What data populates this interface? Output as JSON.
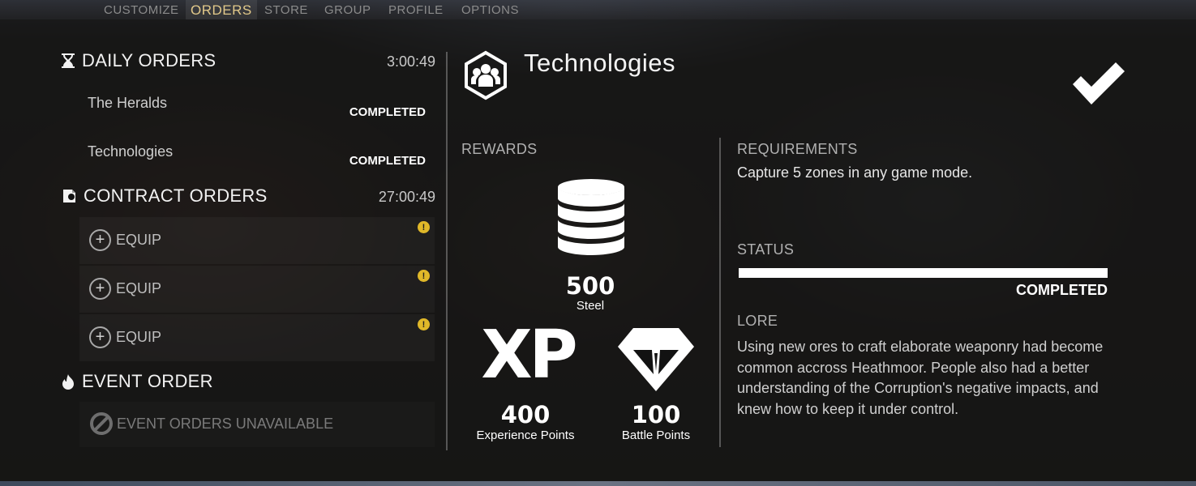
{
  "nav": {
    "tabs": [
      {
        "label": "CUSTOMIZE"
      },
      {
        "label": "ORDERS",
        "active": true
      },
      {
        "label": "STORE"
      },
      {
        "label": "GROUP"
      },
      {
        "label": "PROFILE"
      },
      {
        "label": "OPTIONS"
      }
    ]
  },
  "daily": {
    "title": "DAILY ORDERS",
    "timer": "3:00:49",
    "orders": [
      {
        "name": "The Heralds",
        "status": "COMPLETED"
      },
      {
        "name": "Technologies",
        "status": "COMPLETED"
      }
    ]
  },
  "contract": {
    "title": "CONTRACT ORDERS",
    "timer": "27:00:49",
    "slots": [
      {
        "label": "EQUIP",
        "warning": "!"
      },
      {
        "label": "EQUIP",
        "warning": "!"
      },
      {
        "label": "EQUIP",
        "warning": "!"
      }
    ]
  },
  "event": {
    "title": "EVENT ORDER",
    "unavailable": "EVENT ORDERS UNAVAILABLE"
  },
  "detail": {
    "title": "Technologies",
    "rewards_label": "REWARDS",
    "rewards": {
      "steel": {
        "value": "500",
        "label": "Steel",
        "icon": "steel-stack-icon"
      },
      "xp": {
        "glyph": "XP",
        "value": "400",
        "label": "Experience Points"
      },
      "battle": {
        "value": "100",
        "label": "Battle Points",
        "icon": "diamond-icon"
      }
    },
    "requirements_label": "REQUIREMENTS",
    "requirements": "Capture 5 zones in any game mode.",
    "status_label": "STATUS",
    "status_value": "COMPLETED",
    "status_progress": 1.0,
    "lore_label": "LORE",
    "lore": "Using new ores to craft elaborate weaponry had become common accross Heathmoor. People also had a better understanding of the Corruption's negative impacts, and knew how to keep it under control."
  },
  "colors": {
    "active_tab": "#e2c98a",
    "warning": "#e0b829",
    "panel": "#121212"
  }
}
